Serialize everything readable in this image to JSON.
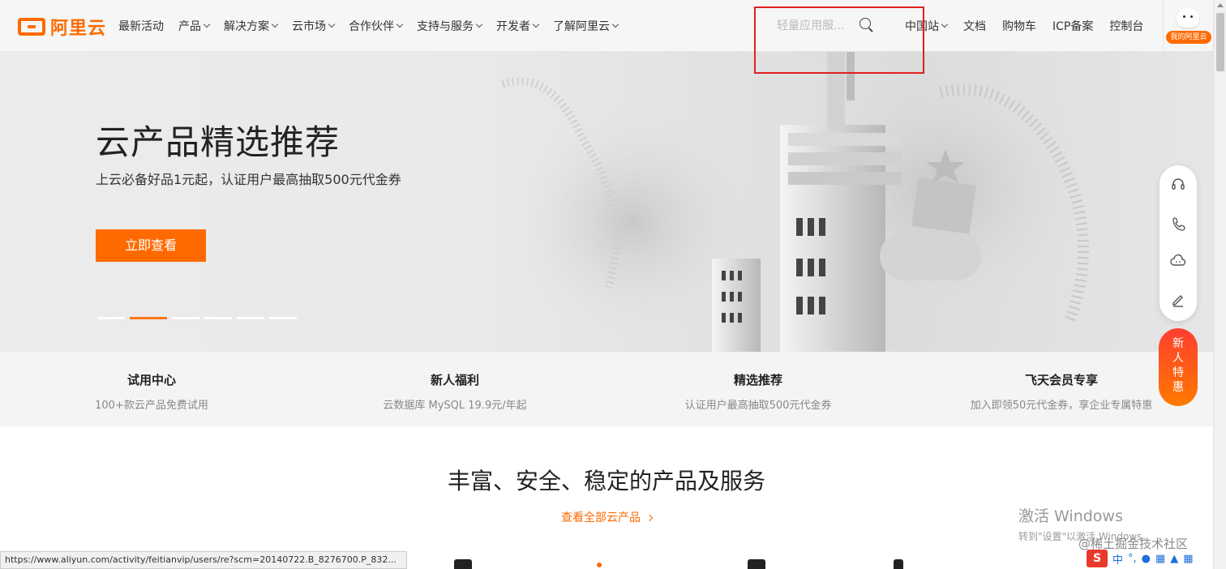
{
  "header": {
    "logo_text": "阿里云",
    "nav": [
      {
        "label": "最新活动",
        "has_dropdown": false
      },
      {
        "label": "产品",
        "has_dropdown": true
      },
      {
        "label": "解决方案",
        "has_dropdown": true
      },
      {
        "label": "云市场",
        "has_dropdown": true
      },
      {
        "label": "合作伙伴",
        "has_dropdown": true
      },
      {
        "label": "支持与服务",
        "has_dropdown": true
      },
      {
        "label": "开发者",
        "has_dropdown": true
      },
      {
        "label": "了解阿里云",
        "has_dropdown": true
      }
    ],
    "search": {
      "placeholder": "轻量应用服..."
    },
    "right_nav": {
      "region": "中国站",
      "docs": "文档",
      "cart": "购物车",
      "icp": "ICP备案",
      "console": "控制台"
    },
    "my_badge": "我的阿里云"
  },
  "hero": {
    "title": "云产品精选推荐",
    "subtitle": "上云必备好品1元起，认证用户最高抽取500元代金券",
    "button": "立即查看",
    "slides_total": 6,
    "slide_active": 2
  },
  "strip": [
    {
      "title": "试用中心",
      "desc": "100+款云产品免费试用"
    },
    {
      "title": "新人福利",
      "desc": "云数据库 MySQL 19.9元/年起"
    },
    {
      "title": "精选推荐",
      "desc": "认证用户最高抽取500元代金券"
    },
    {
      "title": "飞天会员专享",
      "desc": "加入即领50元代金券，享企业专属特惠"
    }
  ],
  "section": {
    "title": "丰富、安全、稳定的产品及服务",
    "link": "查看全部云产品"
  },
  "side_promo": {
    "line1": "新",
    "line2": "人",
    "line3": "特",
    "line4": "惠"
  },
  "status_url": "https://www.aliyun.com/activity/feitianvip/users/re?scm=20140722.B_8276700.P_832...",
  "watermark": {
    "line1": "激活 Windows",
    "line2": "转到\"设置\"以激活 Windows。",
    "site": "@稀土掘金技术社区"
  },
  "ime": {
    "logo": "S",
    "lang": "中"
  },
  "colors": {
    "accent": "#ff6a00",
    "highlight": "#e02020"
  }
}
